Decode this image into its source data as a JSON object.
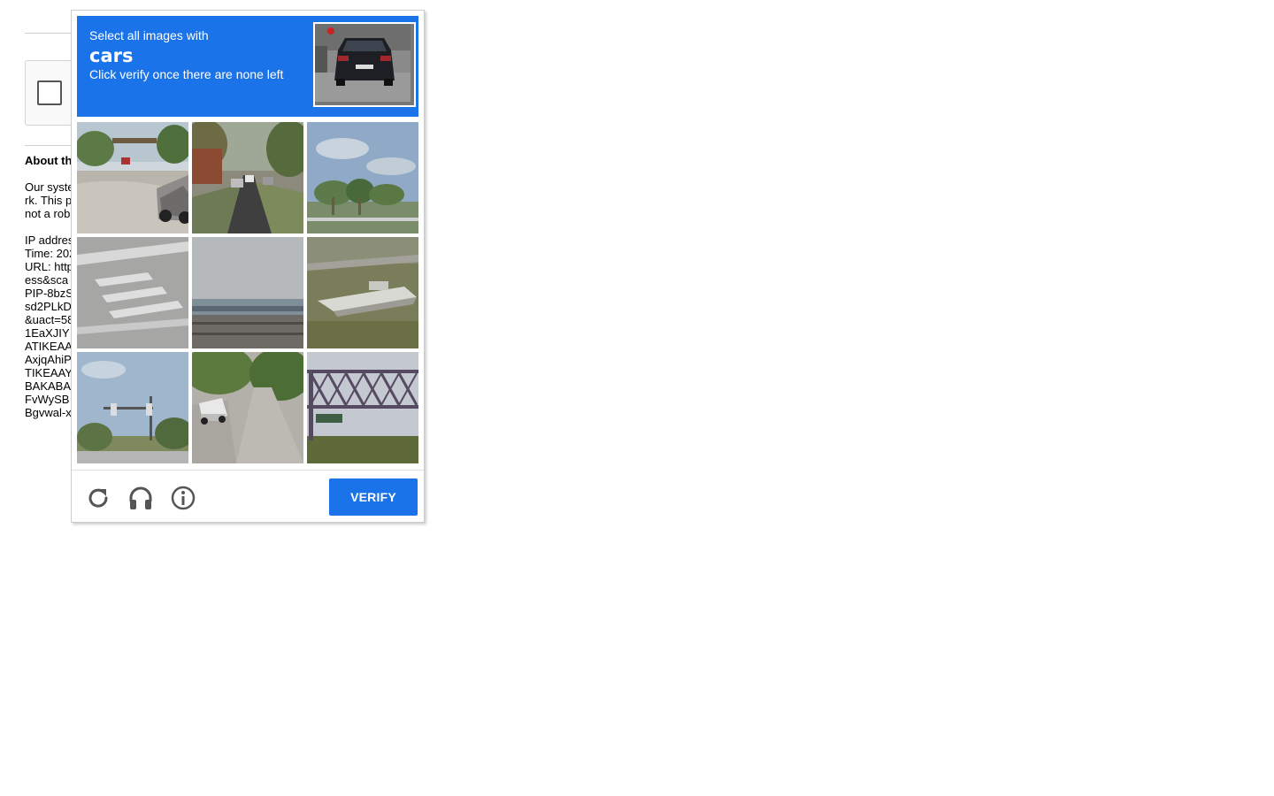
{
  "captcha": {
    "instruction_prefix": "Select all images with",
    "target_object": "cars",
    "instruction_suffix": "Click verify once there are none left",
    "verify_label": "VERIFY",
    "accent_color": "#1a73e8",
    "footer_icons": [
      "reload-icon",
      "headphones-icon",
      "info-icon"
    ],
    "tiles": [
      {
        "index": 1,
        "scene": "road curving with silver car"
      },
      {
        "index": 2,
        "scene": "tree-lined street with parked cars"
      },
      {
        "index": 3,
        "scene": "palm trees under blue sky"
      },
      {
        "index": 4,
        "scene": "crosswalk stripes on road"
      },
      {
        "index": 5,
        "scene": "waterfront under grey sky"
      },
      {
        "index": 6,
        "scene": "boat on grass"
      },
      {
        "index": 7,
        "scene": "traffic lights over road"
      },
      {
        "index": 8,
        "scene": "white car on street with trees"
      },
      {
        "index": 9,
        "scene": "steel truss bridge"
      }
    ]
  },
  "background_page": {
    "about_heading": "About th",
    "about_lines": [
      "Our syste",
      "rk. This p",
      "not a rob"
    ],
    "details_lines": [
      "IP addres",
      "Time: 202",
      "URL: http",
      "ess&sca",
      "PIP-8bzS",
      "sd2PLkD",
      "&uact=58",
      "1EaXJIY",
      "ATIKEAA",
      "AxjqAhiP",
      "TIKEAAY",
      "BAKABA",
      "FvWySB",
      "Bgvwal-x"
    ]
  }
}
